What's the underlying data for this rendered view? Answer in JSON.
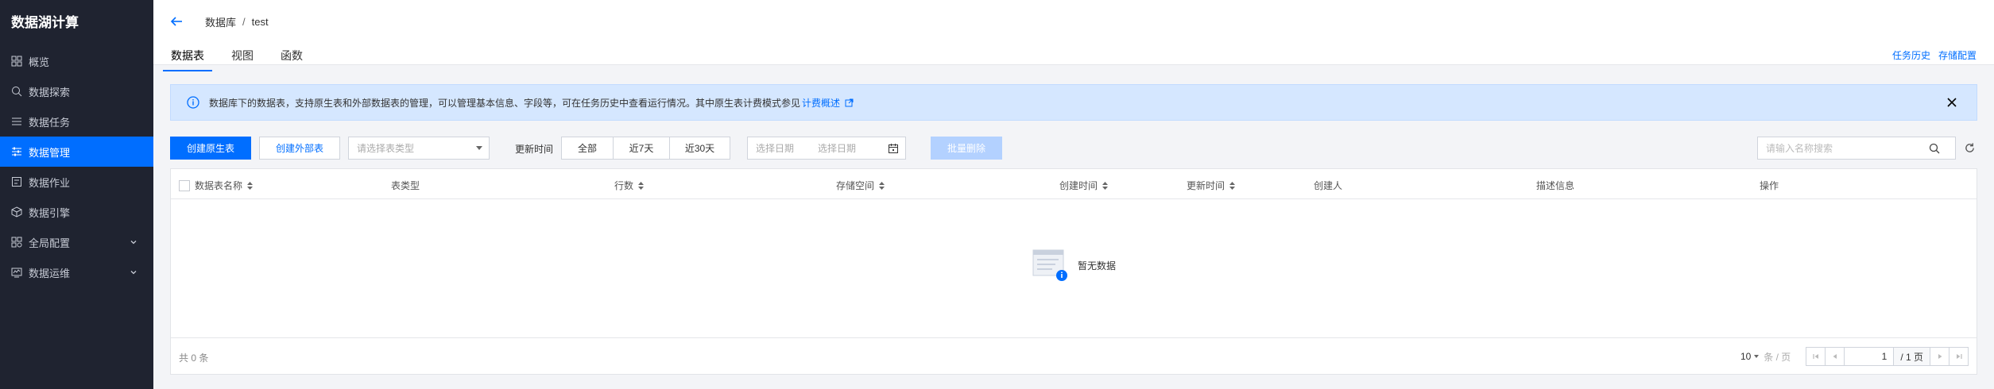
{
  "app": {
    "title": "数据湖计算"
  },
  "sidebar": {
    "items": [
      {
        "label": "概览",
        "icon": "grid-icon"
      },
      {
        "label": "数据探索",
        "icon": "explore-icon"
      },
      {
        "label": "数据任务",
        "icon": "list-icon"
      },
      {
        "label": "数据管理",
        "icon": "manage-icon",
        "active": true
      },
      {
        "label": "数据作业",
        "icon": "job-icon"
      },
      {
        "label": "数据引擎",
        "icon": "engine-icon"
      },
      {
        "label": "全局配置",
        "icon": "config-icon",
        "expandable": true
      },
      {
        "label": "数据运维",
        "icon": "ops-icon",
        "expandable": true
      }
    ]
  },
  "header": {
    "breadcrumb": [
      "数据库",
      "test"
    ],
    "breadcrumb_sep": "/",
    "tabs": [
      "数据表",
      "视图",
      "函数"
    ],
    "active_tab": "数据表",
    "links": [
      "任务历史",
      "存储配置"
    ]
  },
  "banner": {
    "text": "数据库下的数据表，支持原生表和外部数据表的管理，可以管理基本信息、字段等，可在任务历史中查看运行情况。其中原生表计费模式参见",
    "link": "计费概述"
  },
  "toolbar": {
    "create_native": "创建原生表",
    "create_external": "创建外部表",
    "table_type_placeholder": "请选择表类型",
    "update_time_label": "更新时间",
    "range_options": [
      "全部",
      "近7天",
      "近30天"
    ],
    "start_date_placeholder": "选择日期",
    "end_date_placeholder": "选择日期",
    "batch_delete": "批量删除",
    "search_placeholder": "请输入名称搜索"
  },
  "table": {
    "columns": [
      {
        "label": "数据表名称",
        "sortable": true
      },
      {
        "label": "表类型",
        "sortable": false
      },
      {
        "label": "行数",
        "sortable": true
      },
      {
        "label": "存储空间",
        "sortable": true
      },
      {
        "label": "创建时间",
        "sortable": true
      },
      {
        "label": "更新时间",
        "sortable": true
      },
      {
        "label": "创建人",
        "sortable": false
      },
      {
        "label": "描述信息",
        "sortable": false
      },
      {
        "label": "操作",
        "sortable": false
      }
    ],
    "rows": [],
    "empty_text": "暂无数据"
  },
  "footer": {
    "total": "共 0 条",
    "page_size": "10",
    "page_size_unit": "条 / 页",
    "current_page": "1",
    "total_pages": "/ 1 页"
  },
  "colors": {
    "accent": "#006eff",
    "sidebar_bg": "#1f2330",
    "banner_bg": "#d5e7ff"
  }
}
